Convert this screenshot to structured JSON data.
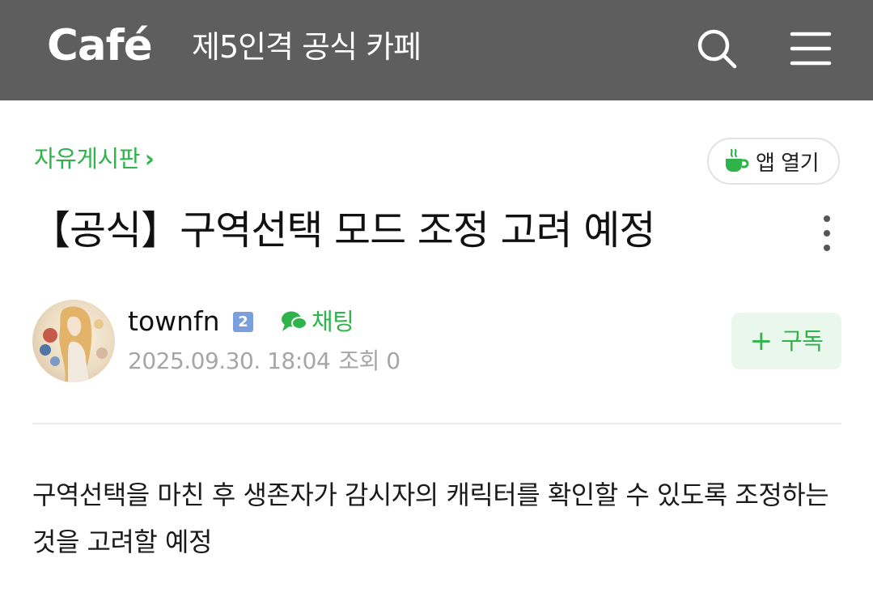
{
  "header": {
    "logo": "Café",
    "cafe_name": "제5인격 공식 카페",
    "icons": {
      "search": "search-icon",
      "menu": "hamburger-menu-icon"
    }
  },
  "board": {
    "name": "자유게시판",
    "chevron": "›"
  },
  "app_button": {
    "label": "앱 열기",
    "icon": "cafe-cup-icon"
  },
  "post": {
    "title": "【공식】구역선택 모드 조정 고려 예정",
    "author": {
      "name": "townfn",
      "level": "2"
    },
    "chat_label": "채팅",
    "date": "2025.09.30. 18:04",
    "views_label": "조회 0",
    "subscribe_label": "구독",
    "subscribe_plus": "+",
    "body": "구역선택을 마친 후 생존자가 감시자의 캐릭터를 확인할 수 있도록 조정하는 것을 고려할 예정"
  },
  "colors": {
    "topbar": "#5e5e5e",
    "accent_green": "#2fb44b",
    "subscribe_bg": "#e9f7ec",
    "meta_gray": "#a6a6a6"
  }
}
